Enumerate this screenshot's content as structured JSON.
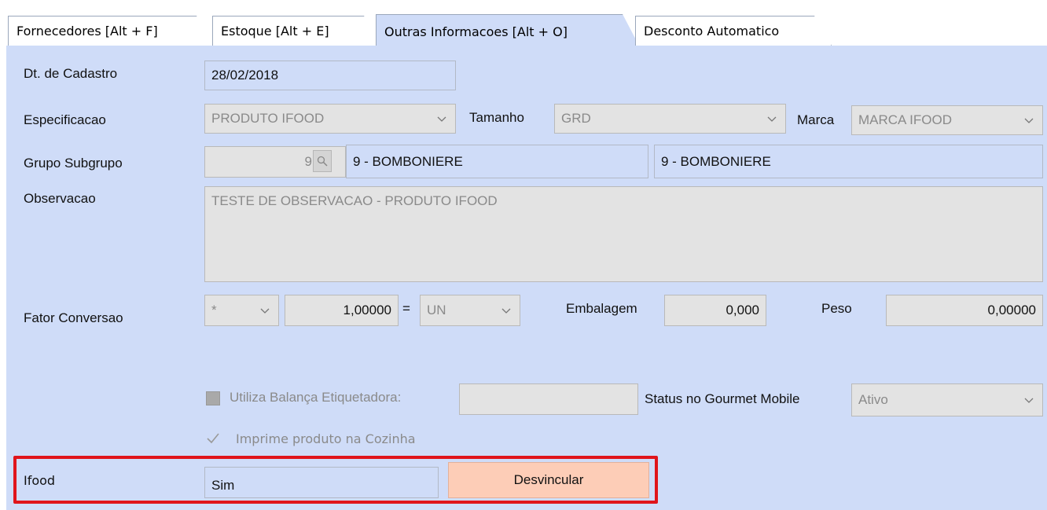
{
  "tabs": [
    {
      "label": "Fornecedores [Alt + F]",
      "active": false
    },
    {
      "label": "Estoque [Alt + E]",
      "active": false
    },
    {
      "label": "Outras Informacoes [Alt + O]",
      "active": true
    },
    {
      "label": "Desconto Automatico",
      "active": false
    }
  ],
  "form": {
    "dt_cadastro": {
      "label": "Dt. de Cadastro",
      "value": "28/02/2018"
    },
    "especificacao": {
      "label": "Especificacao",
      "value": "PRODUTO IFOOD"
    },
    "tamanho": {
      "label": "Tamanho",
      "value": "GRD"
    },
    "marca": {
      "label": "Marca",
      "value": "MARCA IFOOD"
    },
    "grupo": {
      "label": "Grupo Subgrupo",
      "code": "9",
      "grupo_value": "9 - BOMBONIERE",
      "subgrupo_value": "9 - BOMBONIERE"
    },
    "observacao": {
      "label": "Observacao",
      "value": "TESTE DE OBSERVACAO - PRODUTO IFOOD"
    },
    "fator": {
      "label": "Fator Conversao",
      "operator": "*",
      "amount": "1,00000",
      "equals": "=",
      "unit": "UN"
    },
    "embalagem": {
      "label": "Embalagem",
      "value": "0,000"
    },
    "peso": {
      "label": "Peso",
      "value": "0,00000"
    },
    "balanca": {
      "label": "Utiliza Balança Etiquetadora:",
      "checked": false,
      "value": ""
    },
    "status_gourmet": {
      "label": "Status no Gourmet Mobile",
      "value": "Ativo"
    },
    "imprime_cozinha": {
      "label": "Imprime produto na Cozinha",
      "checked": true
    },
    "ifood": {
      "label": "Ifood",
      "value": "Sim",
      "button_label": "Desvincular"
    }
  },
  "colors": {
    "panel": "#cfdcf8",
    "button": "#fdcdb7",
    "highlight": "#e0141b"
  }
}
